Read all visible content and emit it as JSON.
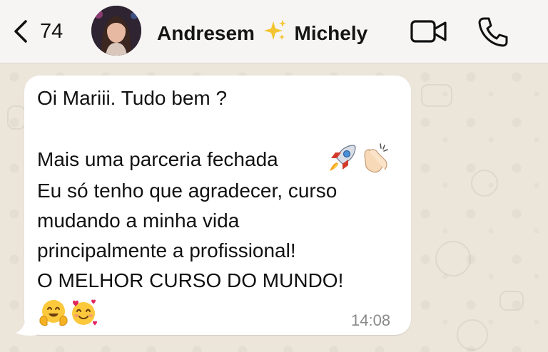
{
  "header": {
    "back_icon": "chevron-left-icon",
    "unread_count": "74",
    "contact_name_part1": "Andresem",
    "contact_name_emoji": "sparkles-icon",
    "contact_name_part2": "Michely",
    "video_icon": "video-camera-icon",
    "call_icon": "phone-icon"
  },
  "message": {
    "line1": "Oi Mariii. Tudo bem ?",
    "line2": "Mais uma parceria fechada",
    "line2_emojis": [
      "rocket-emoji",
      "clapping-hands-emoji"
    ],
    "line3": "Eu só tenho que agradecer, curso",
    "line4": "mudando a minha vida",
    "line5": "principalmente a profissional!",
    "line6": "O MELHOR CURSO DO MUNDO!",
    "line7_emojis": [
      "hugging-face-emoji",
      "smiling-face-with-hearts-emoji"
    ],
    "time": "14:08"
  },
  "colors": {
    "header_bg": "#f6f5f3",
    "chat_bg": "#ece5da",
    "bubble_bg": "#ffffff",
    "text": "#111111",
    "time": "#8a8a8a"
  }
}
